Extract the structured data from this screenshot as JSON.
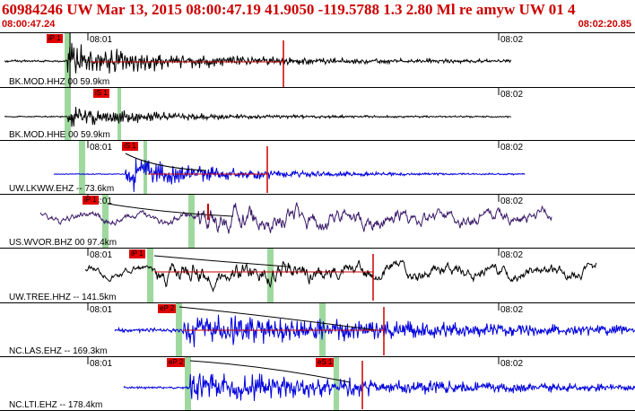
{
  "header": {
    "title": "60984246 UW Mar 13, 2015 08:00:47.19   41.9050 -119.5788  1.3 2.80 Ml re amyw UW 01   4",
    "start_time": "08:00:47.24",
    "end_time": "08:02:20.85"
  },
  "colors": {
    "header_text": "#cc0000",
    "pick_flag": "#e00000",
    "phase_window": "#9fd89f",
    "trace_black": "#000000",
    "trace_blue": "#0000dd",
    "trace_purple": "#3a1a6a"
  },
  "channels": [
    {
      "label": "BK.MOD.HHZ 00 59.9km",
      "t1": "08:01",
      "t2": "08:02",
      "pick": "iP 1",
      "color": "black"
    },
    {
      "label": "BK.MOD.HHE 00 59.9km",
      "t1": "",
      "t2": "08:02",
      "pick": "iS 1",
      "color": "black"
    },
    {
      "label": "UW.LKWW.EHZ -- 73.6km",
      "t1": "08:01",
      "t2": "08:02",
      "pick": "iS 1",
      "color": "blue"
    },
    {
      "label": "US.WVOR.BHZ 00 97.4km",
      "t1": "08:01",
      "t2": "08:02",
      "pick": "iP 1",
      "color": "purple"
    },
    {
      "label": "UW.TREE.HHZ -- 141.5km",
      "t1": "08:01",
      "t2": "08:02",
      "pick": "iP 1",
      "color": "black"
    },
    {
      "label": "NC.LAS.EHZ -- 169.3km",
      "t1": "08:01",
      "t2": "08:02",
      "pick": "eP 2",
      "color": "blue"
    },
    {
      "label": "NC.LTI.EHZ -- 178.4km",
      "t1": "08:01",
      "t2": "08:02",
      "pick": "eP 2",
      "pick2": "eS 1",
      "color": "blue"
    }
  ]
}
